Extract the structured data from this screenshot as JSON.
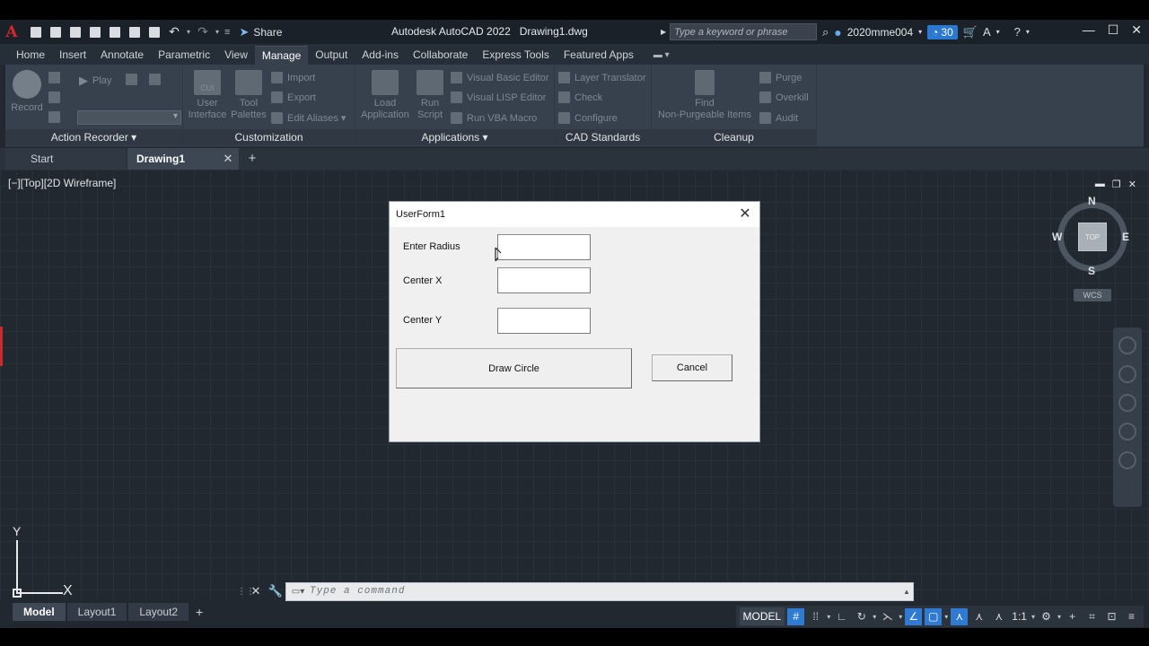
{
  "titlebar": {
    "app_logo": "A",
    "share_label": "Share",
    "app_title": "Autodesk AutoCAD 2022",
    "doc_title": "Drawing1.dwg",
    "search_placeholder": "Type a keyword or phrase",
    "user_name": "2020mme004",
    "trial_badge": "30"
  },
  "ribbon_tabs": [
    "Home",
    "Insert",
    "Annotate",
    "Parametric",
    "View",
    "Manage",
    "Output",
    "Add-ins",
    "Collaborate",
    "Express Tools",
    "Featured Apps"
  ],
  "active_ribbon_tab": "Manage",
  "ribbon": {
    "action_recorder": {
      "record": "Record",
      "play": "Play",
      "panel_title": "Action Recorder ▾"
    },
    "customization": {
      "user_interface_1": "User",
      "user_interface_2": "Interface",
      "user_interface_icon": "CUI",
      "tool_palettes_1": "Tool",
      "tool_palettes_2": "Palettes",
      "import": "Import",
      "export": "Export",
      "edit_aliases": "Edit Aliases ▾",
      "panel_title": "Customization"
    },
    "applications": {
      "load_app_1": "Load",
      "load_app_2": "Application",
      "run_script_1": "Run",
      "run_script_2": "Script",
      "vba_editor": "Visual Basic Editor",
      "lisp_editor": "Visual LISP Editor",
      "run_vba": "Run VBA Macro",
      "panel_title": "Applications ▾"
    },
    "cad_standards": {
      "layer_translator": "Layer Translator",
      "check": "Check",
      "configure": "Configure",
      "panel_title": "CAD Standards"
    },
    "cleanup": {
      "find_1": "Find",
      "find_2": "Non-Purgeable Items",
      "purge": "Purge",
      "overkill": "Overkill",
      "audit": "Audit",
      "panel_title": "Cleanup"
    }
  },
  "file_tabs": {
    "start": "Start",
    "drawing": "Drawing1"
  },
  "viewport": {
    "label": "[−][Top][2D Wireframe]",
    "cube_top": "TOP",
    "north": "N",
    "south": "S",
    "east": "E",
    "west": "W",
    "wcs": "WCS",
    "ucs_x": "X",
    "ucs_y": "Y"
  },
  "dialog": {
    "title": "UserForm1",
    "label_radius": "Enter Radius",
    "label_center_x": "Center X",
    "label_center_y": "Center Y",
    "value_radius": "",
    "value_center_x": "",
    "value_center_y": "",
    "draw_button": "Draw Circle",
    "cancel_button": "Cancel"
  },
  "command_line": {
    "placeholder": "Type a command"
  },
  "layout_tabs": [
    "Model",
    "Layout1",
    "Layout2"
  ],
  "active_layout_tab": "Model",
  "status_bar": {
    "model": "MODEL",
    "scale": "1:1"
  },
  "colors": {
    "accent": "#2f7ad3",
    "canvas": "#212830",
    "ribbon": "#37414d",
    "logo_red": "#d8262b"
  }
}
